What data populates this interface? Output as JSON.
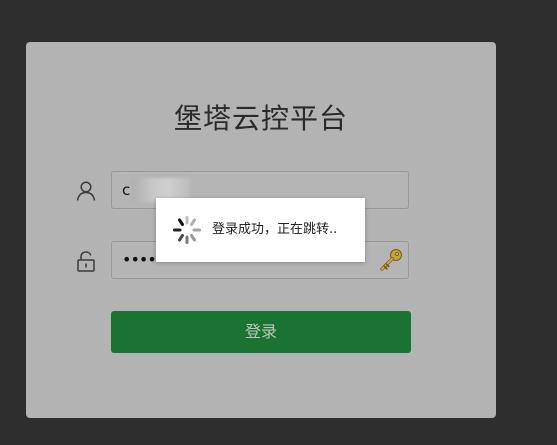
{
  "login": {
    "title": "堡塔云控平台",
    "username_value": "c",
    "password_mask": "•••••",
    "submit_label": "登录"
  },
  "toast": {
    "message": "登录成功，正在跳转.."
  },
  "colors": {
    "background": "#2e2e2e",
    "card": "#b3b3b3",
    "button": "#1a7330",
    "toast": "#ffffff"
  },
  "icons": {
    "username": "user-icon",
    "password": "lock-icon",
    "password_manager": "key-icon",
    "loading": "spinner-icon"
  }
}
